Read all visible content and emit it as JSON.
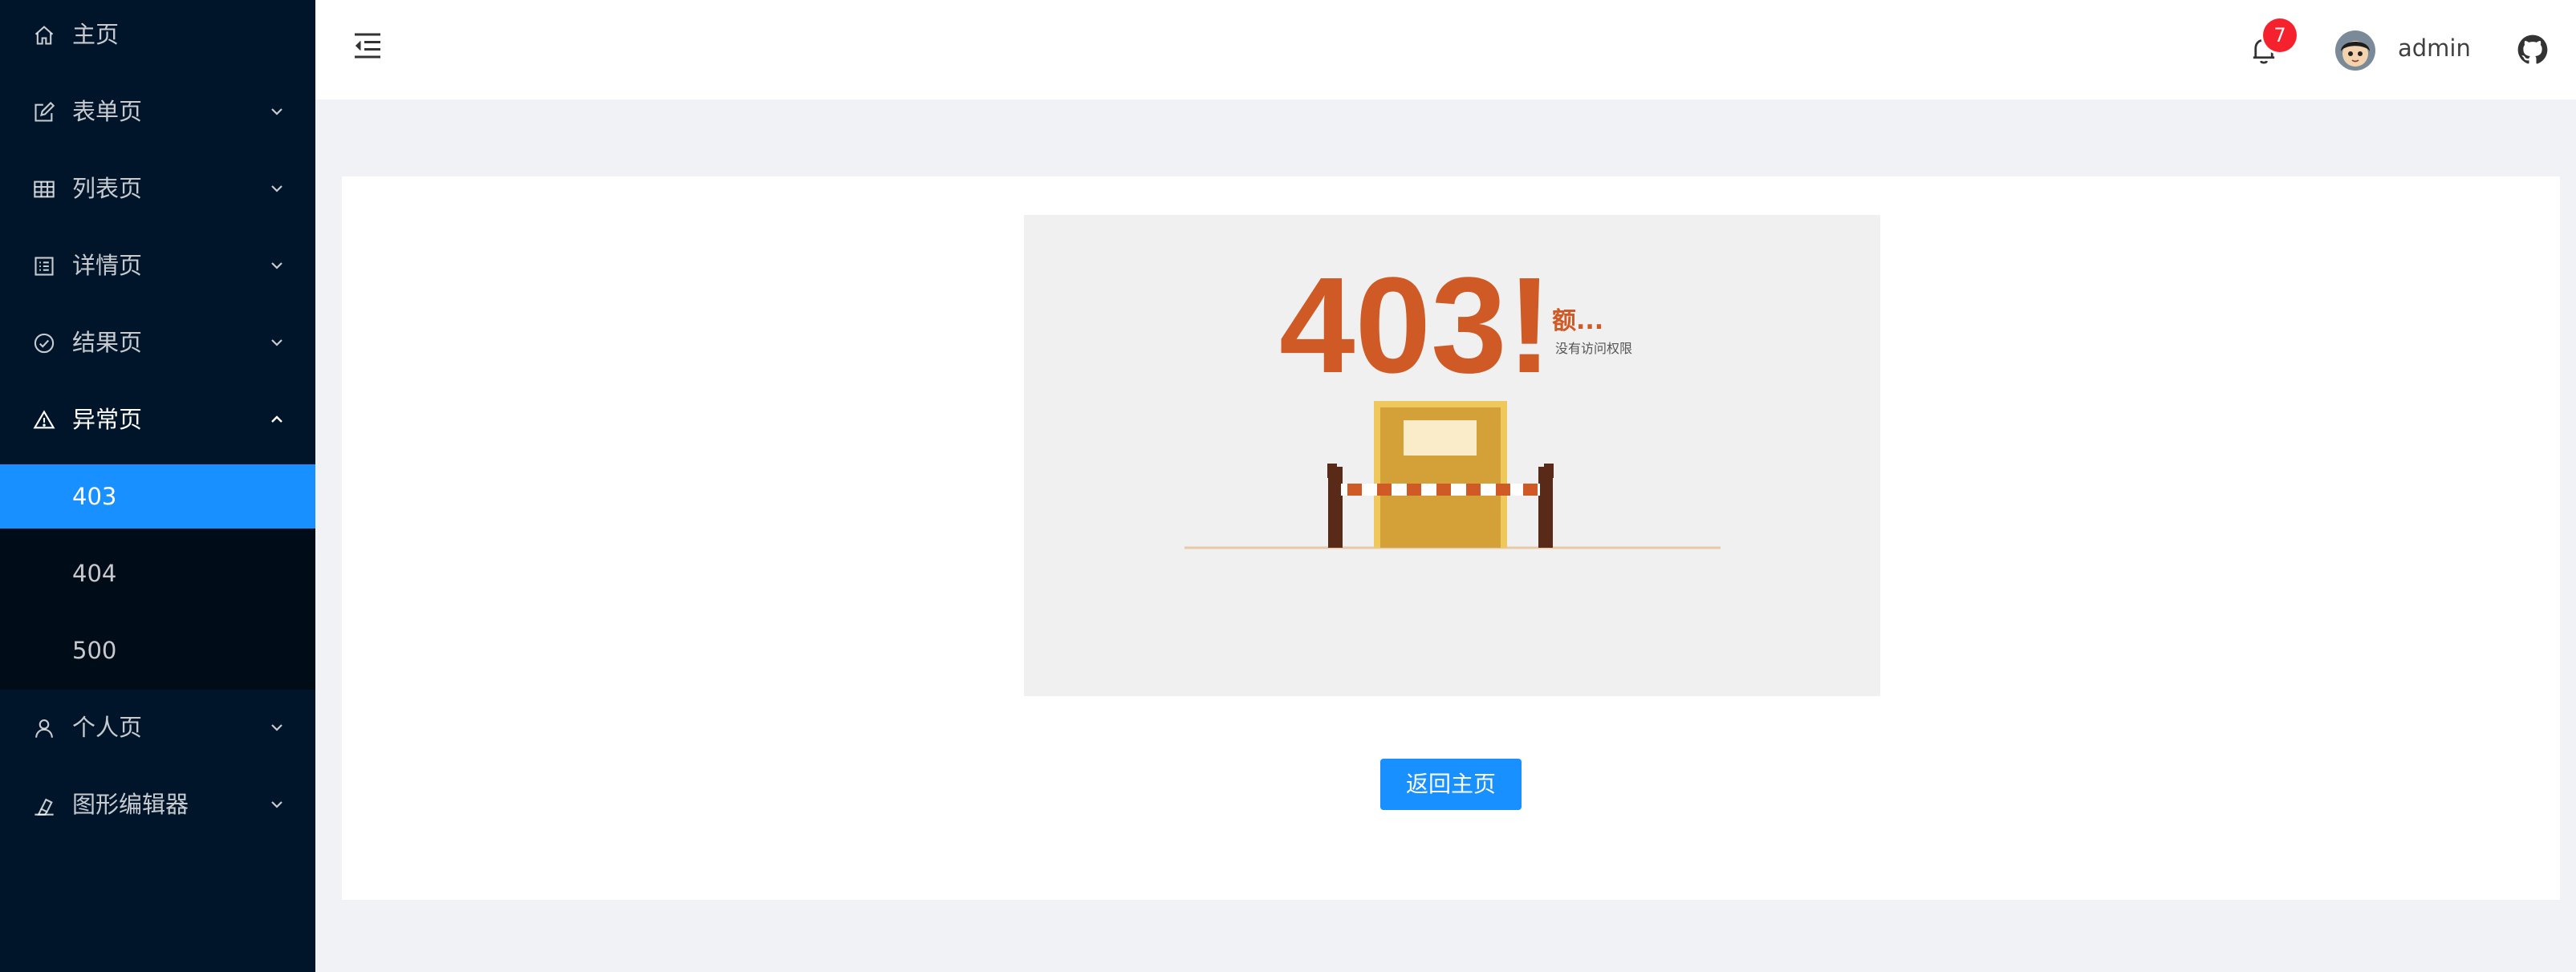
{
  "sidebar": {
    "items": [
      {
        "label": "主页",
        "icon": "home-icon"
      },
      {
        "label": "表单页",
        "icon": "form-icon"
      },
      {
        "label": "列表页",
        "icon": "table-icon"
      },
      {
        "label": "详情页",
        "icon": "profile-icon"
      },
      {
        "label": "结果页",
        "icon": "check-circle-icon"
      },
      {
        "label": "异常页",
        "icon": "warning-icon",
        "expanded": true
      },
      {
        "label": "个人页",
        "icon": "user-icon"
      },
      {
        "label": "图形编辑器",
        "icon": "highlight-icon"
      }
    ],
    "exception_submenu": [
      {
        "label": "403",
        "selected": true
      },
      {
        "label": "404"
      },
      {
        "label": "500"
      }
    ]
  },
  "header": {
    "notification_count": "7",
    "username": "admin",
    "icons": [
      "menu-fold-icon",
      "bell-icon",
      "avatar",
      "github-icon"
    ]
  },
  "exception": {
    "code_text": "403!",
    "subtitle": "额...",
    "message": "没有访问权限",
    "back_button_label": "返回主页"
  },
  "colors": {
    "sidebar_bg": "#001529",
    "submenu_bg": "#000c17",
    "primary": "#1890ff",
    "badge": "#f5222d",
    "illustration_bg": "#f0f0f0",
    "error_orange": "#cf5a26",
    "door_gold": "#d4a038"
  }
}
